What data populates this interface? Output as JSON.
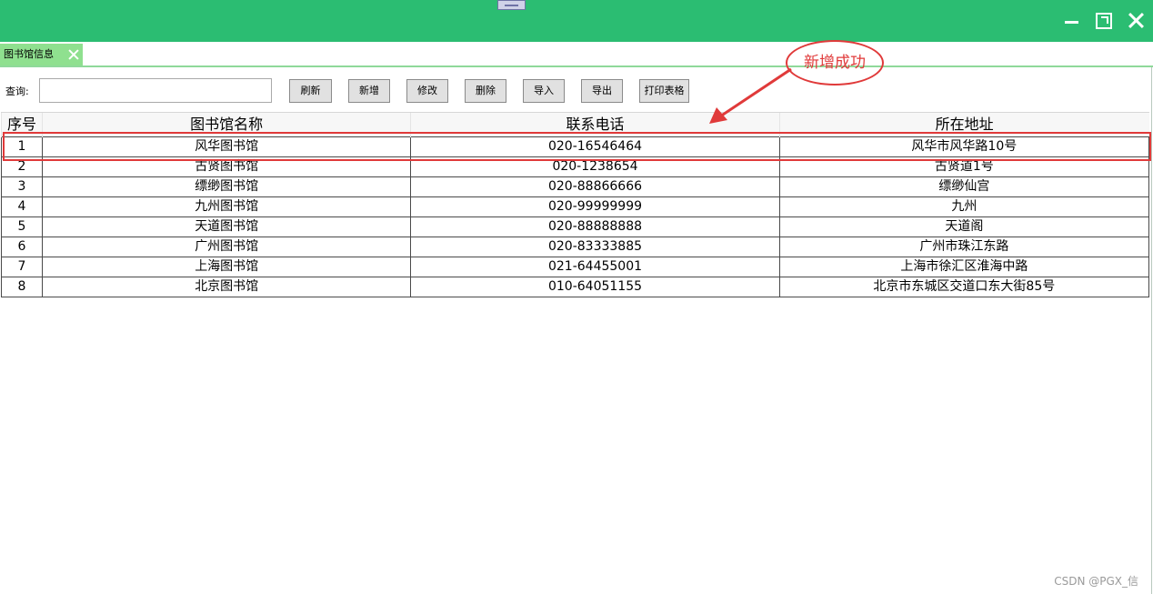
{
  "window": {
    "minimize_icon": "minimize-icon",
    "maximize_icon": "maximize-icon",
    "close_icon": "close-icon",
    "title_bar_color": "#2bbd72"
  },
  "tabs": [
    {
      "label": "图书馆信息",
      "close_icon": "close-icon",
      "color": "#8fe08f"
    }
  ],
  "toolbar": {
    "query_label": "查询:",
    "query_value": "",
    "buttons": [
      "刷新",
      "新增",
      "修改",
      "删除",
      "导入",
      "导出",
      "打印表格"
    ]
  },
  "table": {
    "columns": [
      "序号",
      "图书馆名称",
      "联系电话",
      "所在地址"
    ],
    "rows": [
      [
        "1",
        "风华图书馆",
        "020-16546464",
        "风华市风华路10号"
      ],
      [
        "2",
        "古贤图书馆",
        "020-1238654",
        "古贤道1号"
      ],
      [
        "3",
        "缥缈图书馆",
        "020-88866666",
        "缥缈仙宫"
      ],
      [
        "4",
        "九州图书馆",
        "020-99999999",
        "九州"
      ],
      [
        "5",
        "天道图书馆",
        "020-88888888",
        "天道阁"
      ],
      [
        "6",
        "广州图书馆",
        "020-83333885",
        "广州市珠江东路"
      ],
      [
        "7",
        "上海图书馆",
        "021-64455001",
        "上海市徐汇区淮海中路"
      ],
      [
        "8",
        "北京图书馆",
        "010-64051155",
        "北京市东城区交道口东大街85号"
      ]
    ]
  },
  "annotation": {
    "callout_text": "新增成功",
    "color": "#e03a3a"
  },
  "watermark": "CSDN @PGX_信"
}
